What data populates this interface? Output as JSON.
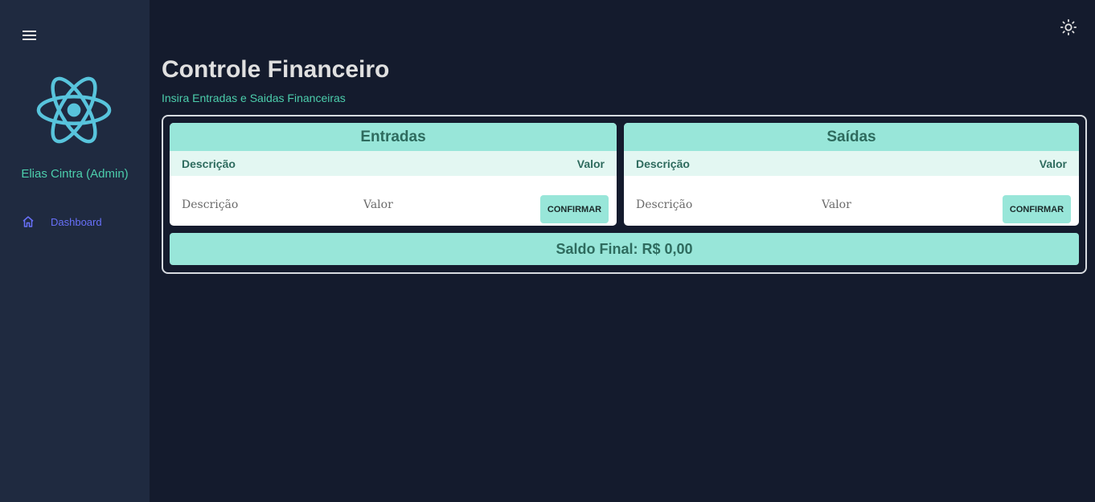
{
  "sidebar": {
    "user_name": "Elias Cintra (Admin)",
    "logo_icon": "react-logo-icon",
    "items": [
      {
        "label": "Dashboard",
        "icon": "home-icon"
      }
    ]
  },
  "header": {
    "theme_icon": "sun-icon"
  },
  "page": {
    "title": "Controle Financeiro",
    "subtitle": "Insira Entradas e Saidas Financeiras"
  },
  "entradas": {
    "title": "Entradas",
    "col_desc": "Descrição",
    "col_valor": "Valor",
    "desc_placeholder": "Descrição",
    "valor_placeholder": "Valor",
    "confirm_label": "CONFIRMAR"
  },
  "saidas": {
    "title": "Saídas",
    "col_desc": "Descrição",
    "col_valor": "Valor",
    "desc_placeholder": "Descrição",
    "valor_placeholder": "Valor",
    "confirm_label": "CONFIRMAR"
  },
  "saldo": {
    "label": "Saldo Final: R$ 0,00"
  },
  "colors": {
    "background": "#141b2d",
    "sidebar": "#1f2a40",
    "accent": "#4cceac",
    "card_header": "#98e6d9",
    "nav_active": "#6870fa",
    "react_blue": "#58c4dc"
  }
}
